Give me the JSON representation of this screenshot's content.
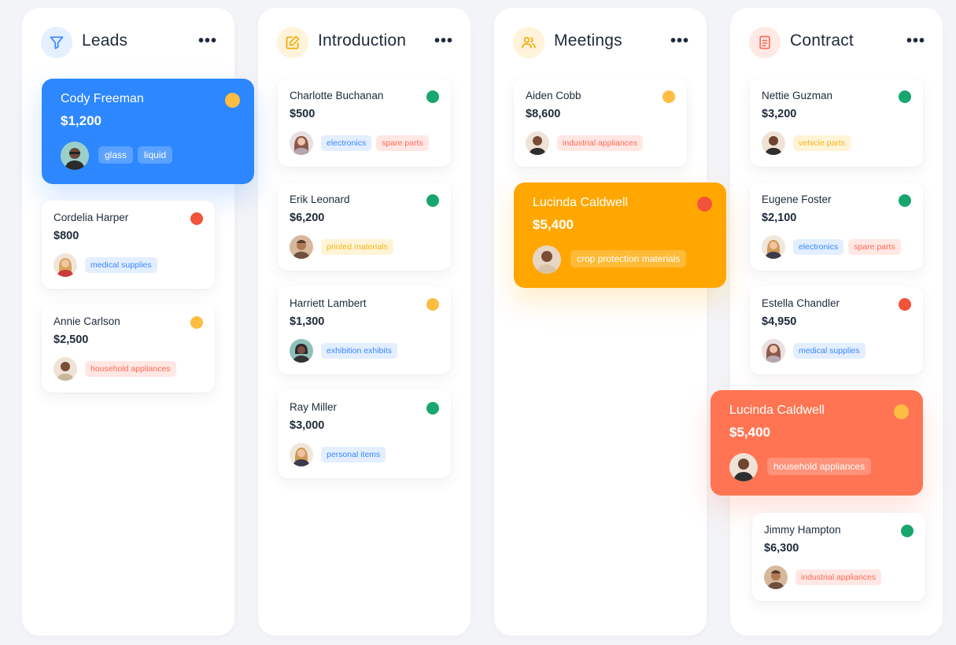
{
  "colors": {
    "green": "#18a66e",
    "yellow": "#fdbd42",
    "red": "#f2533b",
    "blue_card": "#2d87ff",
    "orange_card": "#ffa700",
    "coral_card": "#ff7452"
  },
  "columns": [
    {
      "title": "Leads",
      "icon": "funnel-icon",
      "more": "•••",
      "cards": [
        {
          "name": "Cody Freeman",
          "amount": "$1,200",
          "status": "yellow",
          "tags": [
            "glass",
            "liquid"
          ]
        },
        {
          "name": "Cordelia Harper",
          "amount": "$800",
          "status": "red",
          "tags": [
            "medical supplies"
          ]
        },
        {
          "name": "Annie Carlson",
          "amount": "$2,500",
          "status": "yellow",
          "tags": [
            "household appliances"
          ]
        }
      ]
    },
    {
      "title": "Introduction",
      "icon": "edit-icon",
      "more": "•••",
      "cards": [
        {
          "name": "Charlotte Buchanan",
          "amount": "$500",
          "status": "green",
          "tags": [
            "electronics",
            "spare parts"
          ]
        },
        {
          "name": "Erik Leonard",
          "amount": "$6,200",
          "status": "green",
          "tags": [
            "printed materials"
          ]
        },
        {
          "name": "Harriett Lambert",
          "amount": "$1,300",
          "status": "yellow",
          "tags": [
            "exhibition exhibits"
          ]
        },
        {
          "name": "Ray Miller",
          "amount": "$3,000",
          "status": "green",
          "tags": [
            "personal items"
          ]
        }
      ]
    },
    {
      "title": "Meetings",
      "icon": "users-icon",
      "more": "•••",
      "cards": [
        {
          "name": "Aiden Cobb",
          "amount": "$8,600",
          "status": "yellow",
          "tags": [
            "industrial appliances"
          ]
        },
        {
          "name": "Lucinda Caldwell",
          "amount": "$5,400",
          "status": "red",
          "tags": [
            "crop protection materials"
          ]
        }
      ]
    },
    {
      "title": "Contract",
      "icon": "document-icon",
      "more": "•••",
      "cards": [
        {
          "name": "Nettie Guzman",
          "amount": "$3,200",
          "status": "green",
          "tags": [
            "vehicle parts"
          ]
        },
        {
          "name": "Eugene Foster",
          "amount": "$2,100",
          "status": "green",
          "tags": [
            "electronics",
            "spare parts"
          ]
        },
        {
          "name": "Estella Chandler",
          "amount": "$4,950",
          "status": "red",
          "tags": [
            "medical supplies"
          ]
        },
        {
          "name": "Lucinda Caldwell",
          "amount": "$5,400",
          "status": "yellow",
          "tags": [
            "household appliances"
          ]
        },
        {
          "name": "Jimmy Hampton",
          "amount": "$6,300",
          "status": "green",
          "tags": [
            "industrial appliances"
          ]
        }
      ]
    }
  ]
}
